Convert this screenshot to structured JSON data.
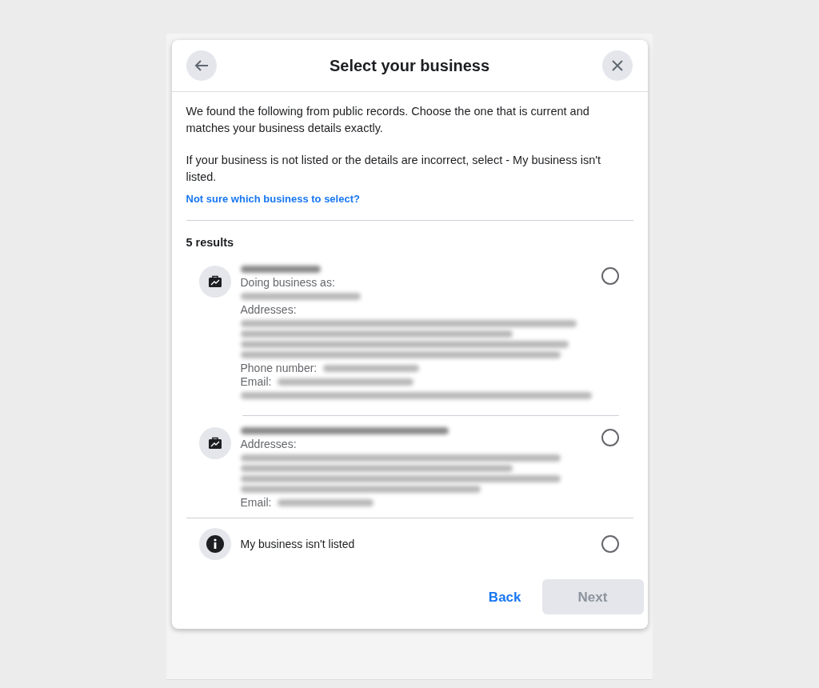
{
  "dialog": {
    "title": "Select your business"
  },
  "intro": [
    "We found the following from public records. Choose the one that is current and matches your business details exactly.",
    "If your business is not listed or the details are incorrect, select - My business isn't listed."
  ],
  "help_link": "Not sure which business to select?",
  "results_count": "5 results",
  "results": [
    {
      "kind": "business",
      "selected": false,
      "name": [
        {
          "kind": "redacted"
        }
      ],
      "fields": [
        {
          "label": "Doing business as:",
          "kind": "stacked",
          "redacted": [
            {
              "kind": "redacted"
            }
          ]
        },
        {
          "label": "Addresses:",
          "kind": "stacked",
          "redacted": [
            {
              "kind": "redacted"
            },
            {
              "kind": "redacted"
            },
            {
              "kind": "redacted"
            },
            {
              "kind": "redacted"
            }
          ]
        },
        {
          "label": "Phone number:",
          "kind": "inline",
          "redacted": [
            {
              "kind": "redacted"
            }
          ]
        },
        {
          "label": "Email:",
          "kind": "inline",
          "redacted": [
            {
              "kind": "redacted"
            },
            {
              "kind": "redacted"
            }
          ]
        }
      ]
    },
    {
      "kind": "business",
      "selected": false,
      "name": [
        {
          "kind": "redacted"
        }
      ],
      "fields": [
        {
          "label": "Addresses:",
          "kind": "stacked",
          "redacted": [
            {
              "kind": "redacted"
            },
            {
              "kind": "redacted"
            },
            {
              "kind": "redacted"
            },
            {
              "kind": "redacted"
            }
          ]
        },
        {
          "label": "Email:",
          "kind": "inline",
          "redacted": [
            {
              "kind": "redacted"
            }
          ]
        }
      ]
    },
    {
      "kind": "not_listed",
      "selected": false,
      "label": "My business isn't listed"
    }
  ],
  "buttons": {
    "back": "Back",
    "next": {
      "label": "Next",
      "disabled": true
    }
  }
}
